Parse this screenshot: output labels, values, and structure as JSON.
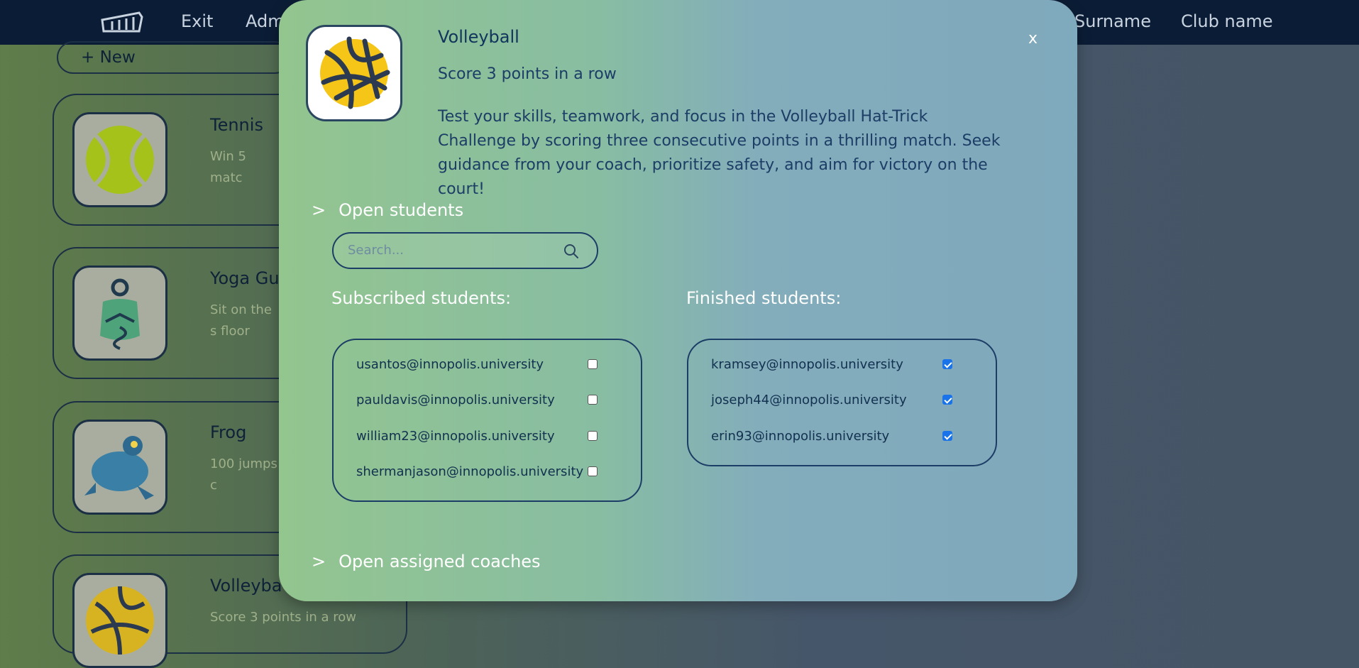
{
  "nav": {
    "items": [
      "Exit",
      "Adm",
      "Surname",
      "Club name"
    ]
  },
  "background": {
    "new_button": "+ New",
    "cards": [
      {
        "title": "Tennis",
        "subtitle": "Win 5 matc",
        "icon": "tennis-ball-icon"
      },
      {
        "title": "Yoga Gur",
        "subtitle": "Sit on the s floor",
        "icon": "yoga-figure-icon"
      },
      {
        "title": "Frog",
        "subtitle": "100 jumps c",
        "icon": "frog-icon"
      },
      {
        "title": "Volleyba",
        "subtitle": "Score 3 points in a row",
        "icon": "volleyball-icon"
      }
    ]
  },
  "modal": {
    "title": "Volleyball",
    "subtitle": "Score 3 points in a row",
    "description": "Test your skills, teamwork, and focus in the Volleyball Hat-Trick Challenge by scoring three consecutive points in a thrilling match. Seek guidance from your coach, prioritize safety, and aim for victory on the court!",
    "close_label": "x",
    "students_toggle": "Open students",
    "coaches_toggle": "Open assigned coaches",
    "toggle_chevron": ">",
    "search": {
      "placeholder": "Search...",
      "value": ""
    },
    "subscribed_heading": "Subscribed students:",
    "finished_heading": "Finished students:",
    "subscribed": [
      {
        "email": "usantos@innopolis.university",
        "checked": false
      },
      {
        "email": "pauldavis@innopolis.university",
        "checked": false
      },
      {
        "email": "william23@innopolis.university",
        "checked": false
      },
      {
        "email": "shermanjason@innopolis.university",
        "checked": false
      }
    ],
    "finished": [
      {
        "email": "kramsey@innopolis.university",
        "checked": true
      },
      {
        "email": "joseph44@innopolis.university",
        "checked": true
      },
      {
        "email": "erin93@innopolis.university",
        "checked": true
      }
    ]
  },
  "colors": {
    "nav_bg": "#0b1d36",
    "modal_text": "#1c3d66",
    "volleyball_yellow": "#f5c518",
    "check_blue": "#1a73e8"
  }
}
